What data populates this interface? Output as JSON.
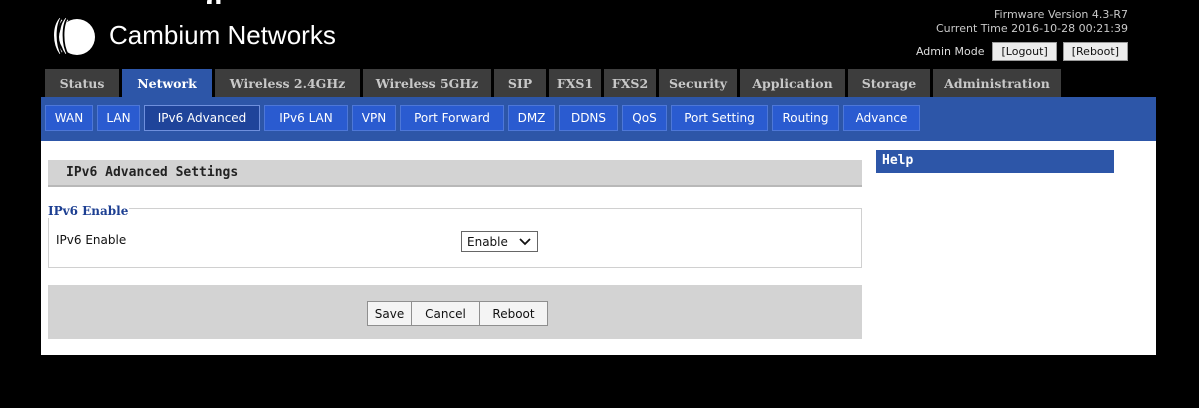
{
  "header": {
    "page_title_fragment": "g",
    "brand": "Cambium Networks",
    "firmware": "Firmware Version 4.3-R7",
    "current_time": "Current Time 2016-10-28 00:21:39",
    "admin_mode": "Admin Mode",
    "logout": "[Logout]",
    "reboot": "[Reboot]"
  },
  "main_tabs": [
    {
      "label": "Status"
    },
    {
      "label": "Network",
      "active": true
    },
    {
      "label": "Wireless 2.4GHz"
    },
    {
      "label": "Wireless 5GHz"
    },
    {
      "label": "SIP"
    },
    {
      "label": "FXS1"
    },
    {
      "label": "FXS2"
    },
    {
      "label": "Security"
    },
    {
      "label": "Application"
    },
    {
      "label": "Storage"
    },
    {
      "label": "Administration"
    }
  ],
  "sub_tabs": [
    {
      "label": "WAN"
    },
    {
      "label": "LAN"
    },
    {
      "label": "IPv6 Advanced",
      "active": true
    },
    {
      "label": "IPv6 LAN"
    },
    {
      "label": "VPN"
    },
    {
      "label": "Port Forward"
    },
    {
      "label": "DMZ"
    },
    {
      "label": "DDNS"
    },
    {
      "label": "QoS"
    },
    {
      "label": "Port Setting"
    },
    {
      "label": "Routing"
    },
    {
      "label": "Advance"
    }
  ],
  "section": {
    "title": "IPv6 Advanced Settings",
    "fieldset_legend": "IPv6 Enable",
    "field_label": "IPv6 Enable",
    "select_value": "Enable"
  },
  "buttons": {
    "save": "Save",
    "cancel": "Cancel",
    "reboot": "Reboot"
  },
  "help": {
    "title": "Help"
  },
  "colors": {
    "accent_blue": "#2d56a8",
    "sub_tab_blue": "#2a5bd0",
    "tab_gray": "#3d3d3d",
    "panel_gray": "#d3d3d3"
  }
}
